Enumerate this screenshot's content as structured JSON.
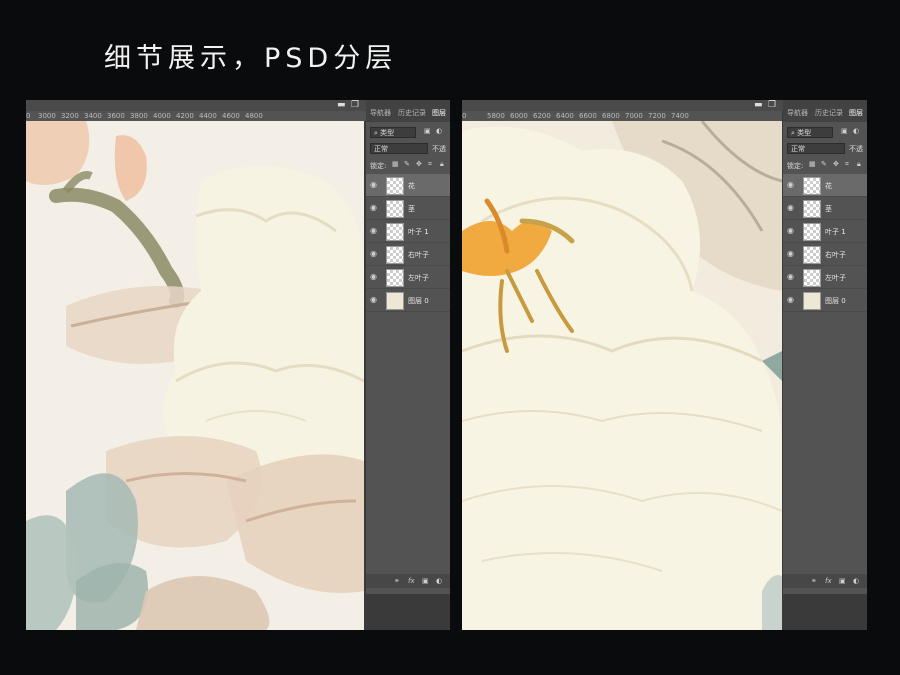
{
  "heading": "细节展示，PSD分层",
  "left_window": {
    "ruler_ticks": [
      "0",
      "3000",
      "3200",
      "3400",
      "3600",
      "3800",
      "4000",
      "4200",
      "4400",
      "4600",
      "4800"
    ],
    "panel_tabs": [
      "导航器",
      "历史记录",
      "图层"
    ],
    "filter_label": "类型",
    "blend_mode": "正常",
    "opacity_label": "不透",
    "lock_label": "锁定:",
    "layers": [
      {
        "name": "花",
        "selected": true
      },
      {
        "name": "茎",
        "selected": false
      },
      {
        "name": "叶子 1",
        "selected": false
      },
      {
        "name": "右叶子",
        "selected": false
      },
      {
        "name": "左叶子",
        "selected": false
      },
      {
        "name": "图层 0",
        "selected": false
      }
    ],
    "footer_icons": [
      "link-icon",
      "fx-icon",
      "mask-icon",
      "adjustment-icon"
    ],
    "footer_fx": "fx"
  },
  "right_window": {
    "ruler_ticks": [
      "0",
      "5800",
      "6000",
      "6200",
      "6400",
      "6600",
      "6800",
      "7000",
      "7200",
      "7400"
    ],
    "panel_tabs": [
      "导航器",
      "历史记录",
      "图层"
    ],
    "filter_label": "类型",
    "blend_mode": "正常",
    "opacity_label": "不透",
    "lock_label": "锁定:",
    "layers": [
      {
        "name": "花",
        "selected": true
      },
      {
        "name": "茎",
        "selected": false
      },
      {
        "name": "叶子 1",
        "selected": false
      },
      {
        "name": "右叶子",
        "selected": false
      },
      {
        "name": "左叶子",
        "selected": false
      },
      {
        "name": "图层 0",
        "selected": false
      }
    ],
    "footer_fx": "fx"
  },
  "colors": {
    "background": "#0a0b0c",
    "panel": "#535353",
    "canvas_paper": "#f3efe6",
    "flower_white": "#f7f3e2",
    "leaf_beige": "#e6d6c4",
    "leaf_teal": "#a9bdb6",
    "stamen_orange": "#f0a537",
    "stem_olive": "#8a8a64"
  }
}
